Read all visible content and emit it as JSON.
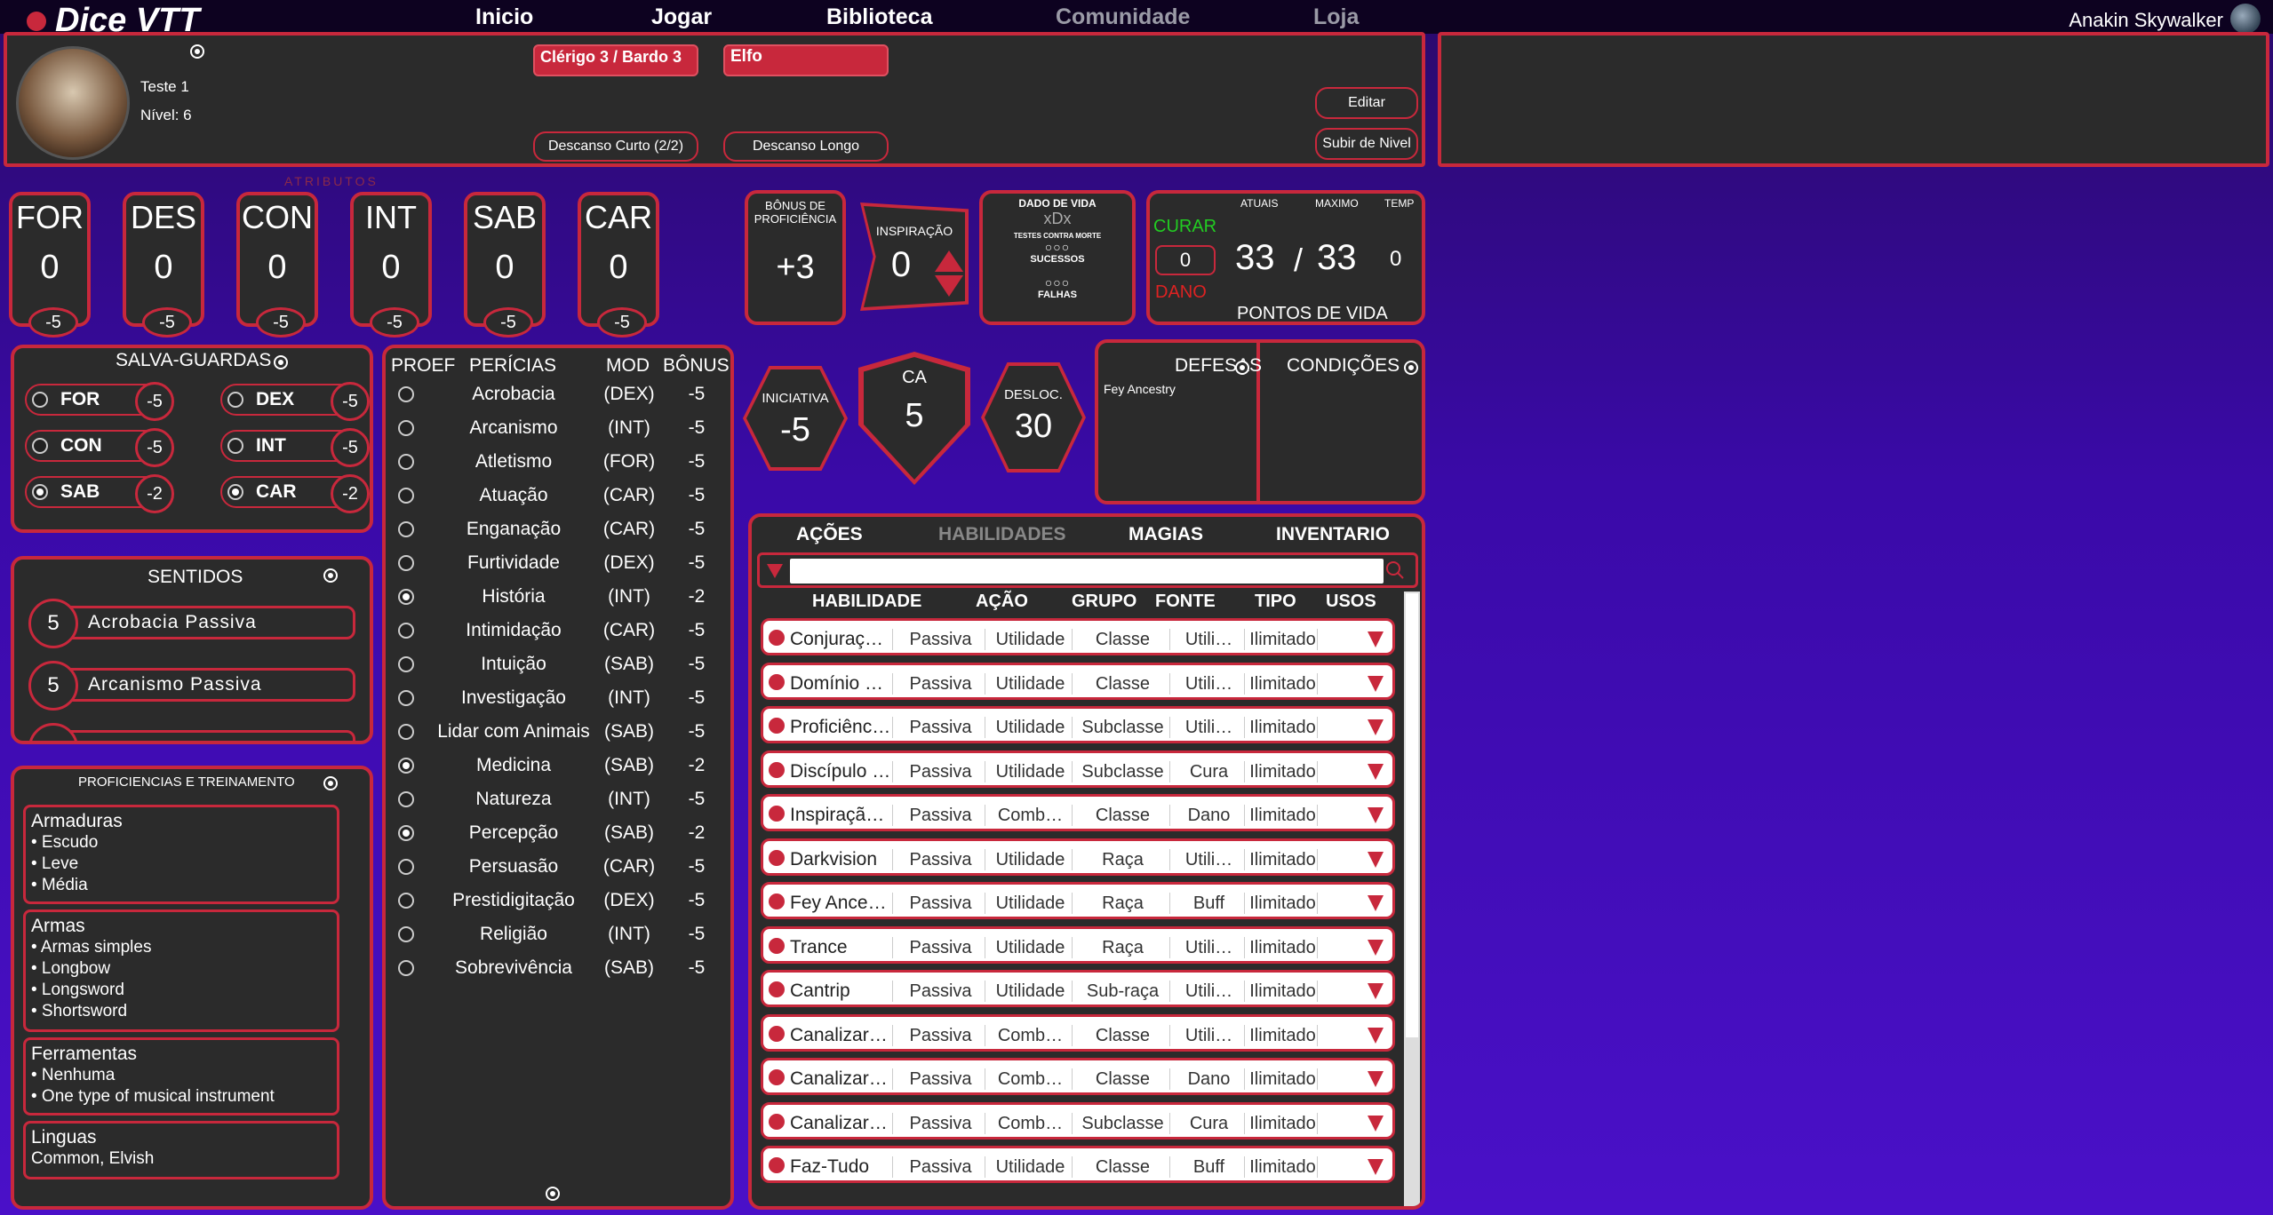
{
  "nav": {
    "brand": "Dice VTT",
    "items": [
      "Inicio",
      "Jogar",
      "Biblioteca",
      "Comunidade",
      "Loja"
    ],
    "user": "Anakin Skywalker"
  },
  "character": {
    "name": "Teste 1",
    "level": "Nível: 6",
    "class": "Clérigo 3 / Bardo 3",
    "race": "Elfo",
    "short_rest": "Descanso Curto (2/2)",
    "long_rest": "Descanso Longo",
    "edit": "Editar",
    "level_up": "Subir de Nivel"
  },
  "attributes_label": "ATRIBUTOS",
  "attributes": [
    {
      "abbr": "FOR",
      "value": "0",
      "mod": "-5"
    },
    {
      "abbr": "DES",
      "value": "0",
      "mod": "-5"
    },
    {
      "abbr": "CON",
      "value": "0",
      "mod": "-5"
    },
    {
      "abbr": "INT",
      "value": "0",
      "mod": "-5"
    },
    {
      "abbr": "SAB",
      "value": "0",
      "mod": "-5"
    },
    {
      "abbr": "CAR",
      "value": "0",
      "mod": "-5"
    }
  ],
  "proficiency": {
    "label": "BÔNUS DE PROFICIÊNCIA",
    "value": "+3"
  },
  "inspiration": {
    "label": "INSPIRAÇÃO",
    "value": "0"
  },
  "hit_dice": {
    "label": "DADO DE VIDA",
    "value": "xDx",
    "death_saves": "TESTES CONTRA MORTE",
    "successes": "SUCESSOS",
    "failures": "FALHAS"
  },
  "hp": {
    "heal": "CURAR",
    "damage": "DANO",
    "input": "0",
    "current_label": "ATUAIS",
    "max_label": "MAXIMO",
    "temp_label": "TEMP",
    "current": "33",
    "sep": "/",
    "max": "33",
    "temp": "0",
    "title": "PONTOS DE VIDA"
  },
  "saves": {
    "title": "SALVA-GUARDAS",
    "items": [
      {
        "abbr": "FOR",
        "value": "-5",
        "prof": false
      },
      {
        "abbr": "DEX",
        "value": "-5",
        "prof": false
      },
      {
        "abbr": "CON",
        "value": "-5",
        "prof": false
      },
      {
        "abbr": "INT",
        "value": "-5",
        "prof": false
      },
      {
        "abbr": "SAB",
        "value": "-2",
        "prof": true
      },
      {
        "abbr": "CAR",
        "value": "-2",
        "prof": true
      }
    ]
  },
  "skills": {
    "headers": {
      "prof": "PROEF",
      "skill": "PERÍCIAS",
      "mod": "MOD",
      "bonus": "BÔNUS"
    },
    "items": [
      {
        "name": "Acrobacia",
        "mod": "(DEX)",
        "bonus": "-5",
        "prof": false
      },
      {
        "name": "Arcanismo",
        "mod": "(INT)",
        "bonus": "-5",
        "prof": false
      },
      {
        "name": "Atletismo",
        "mod": "(FOR)",
        "bonus": "-5",
        "prof": false
      },
      {
        "name": "Atuação",
        "mod": "(CAR)",
        "bonus": "-5",
        "prof": false
      },
      {
        "name": "Enganação",
        "mod": "(CAR)",
        "bonus": "-5",
        "prof": false
      },
      {
        "name": "Furtividade",
        "mod": "(DEX)",
        "bonus": "-5",
        "prof": false
      },
      {
        "name": "História",
        "mod": "(INT)",
        "bonus": "-2",
        "prof": true
      },
      {
        "name": "Intimidação",
        "mod": "(CAR)",
        "bonus": "-5",
        "prof": false
      },
      {
        "name": "Intuição",
        "mod": "(SAB)",
        "bonus": "-5",
        "prof": false
      },
      {
        "name": "Investigação",
        "mod": "(INT)",
        "bonus": "-5",
        "prof": false
      },
      {
        "name": "Lidar com Animais",
        "mod": "(SAB)",
        "bonus": "-5",
        "prof": false
      },
      {
        "name": "Medicina",
        "mod": "(SAB)",
        "bonus": "-2",
        "prof": true
      },
      {
        "name": "Natureza",
        "mod": "(INT)",
        "bonus": "-5",
        "prof": false
      },
      {
        "name": "Percepção",
        "mod": "(SAB)",
        "bonus": "-2",
        "prof": true
      },
      {
        "name": "Persuasão",
        "mod": "(CAR)",
        "bonus": "-5",
        "prof": false
      },
      {
        "name": "Prestidigitação",
        "mod": "(DEX)",
        "bonus": "-5",
        "prof": false
      },
      {
        "name": "Religião",
        "mod": "(INT)",
        "bonus": "-5",
        "prof": false
      },
      {
        "name": "Sobrevivência",
        "mod": "(SAB)",
        "bonus": "-5",
        "prof": false
      }
    ]
  },
  "initiative": {
    "label": "INICIATIVA",
    "value": "-5"
  },
  "ac": {
    "label": "CA",
    "value": "5"
  },
  "speed": {
    "label": "DESLOC.",
    "value": "30"
  },
  "defenses": {
    "title": "DEFESAS",
    "items": [
      "Fey Ancestry"
    ]
  },
  "conditions": {
    "title": "CONDIÇÕES"
  },
  "senses": {
    "title": "SENTIDOS",
    "items": [
      {
        "value": "5",
        "name": "Acrobacia Passiva"
      },
      {
        "value": "5",
        "name": "Arcanismo Passiva"
      }
    ]
  },
  "proficiencies": {
    "title": "PROFICIENCIAS E TREINAMENTO",
    "armor": {
      "title": "Armaduras",
      "items": [
        "• Escudo",
        "• Leve",
        "• Média"
      ]
    },
    "weapons": {
      "title": "Armas",
      "items": [
        "• Armas simples",
        "• Longbow",
        "• Longsword",
        "• Shortsword"
      ]
    },
    "tools": {
      "title": "Ferramentas",
      "items": [
        "• Nenhuma",
        "• One type of musical instrument"
      ]
    },
    "languages": {
      "title": "Linguas",
      "text": "Common, Elvish"
    }
  },
  "tabs": [
    "AÇÕES",
    "HABILIDADES",
    "MAGIAS",
    "INVENTARIO"
  ],
  "abilities": {
    "headers": [
      "HABILIDADE",
      "AÇÃO",
      "GRUPO",
      "FONTE",
      "TIPO",
      "USOS"
    ],
    "rows": [
      [
        "Conjuração…",
        "Passiva",
        "Utilidade",
        "Classe",
        "Utili…",
        "Ilimitado"
      ],
      [
        "Domínio Di…",
        "Passiva",
        "Utilidade",
        "Classe",
        "Utili…",
        "Ilimitado"
      ],
      [
        "Proficiênci…",
        "Passiva",
        "Utilidade",
        "Subclasse",
        "Utili…",
        "Ilimitado"
      ],
      [
        "Discípulo d…",
        "Passiva",
        "Utilidade",
        "Subclasse",
        "Cura",
        "Ilimitado"
      ],
      [
        "Inspiração …",
        "Passiva",
        "Comb…",
        "Classe",
        "Dano",
        "Ilimitado"
      ],
      [
        "Darkvision",
        "Passiva",
        "Utilidade",
        "Raça",
        "Utili…",
        "Ilimitado"
      ],
      [
        "Fey Ancestry",
        "Passiva",
        "Utilidade",
        "Raça",
        "Buff",
        "Ilimitado"
      ],
      [
        "Trance",
        "Passiva",
        "Utilidade",
        "Raça",
        "Utili…",
        "Ilimitado"
      ],
      [
        "Cantrip",
        "Passiva",
        "Utilidade",
        "Sub-raça",
        "Utili…",
        "Ilimitado"
      ],
      [
        "Canalizar D…",
        "Passiva",
        "Comb…",
        "Classe",
        "Utili…",
        "Ilimitado"
      ],
      [
        "Canalizar D…",
        "Passiva",
        "Comb…",
        "Classe",
        "Dano",
        "Ilimitado"
      ],
      [
        "Canalizar D…",
        "Passiva",
        "Comb…",
        "Subclasse",
        "Cura",
        "Ilimitado"
      ],
      [
        "Faz-Tudo",
        "Passiva",
        "Utilidade",
        "Classe",
        "Buff",
        "Ilimitado"
      ]
    ]
  },
  "colors": {
    "accent": "#c8283c",
    "panel": "#2b2b2b",
    "heal": "#22cc22",
    "damage": "#dd2222"
  }
}
